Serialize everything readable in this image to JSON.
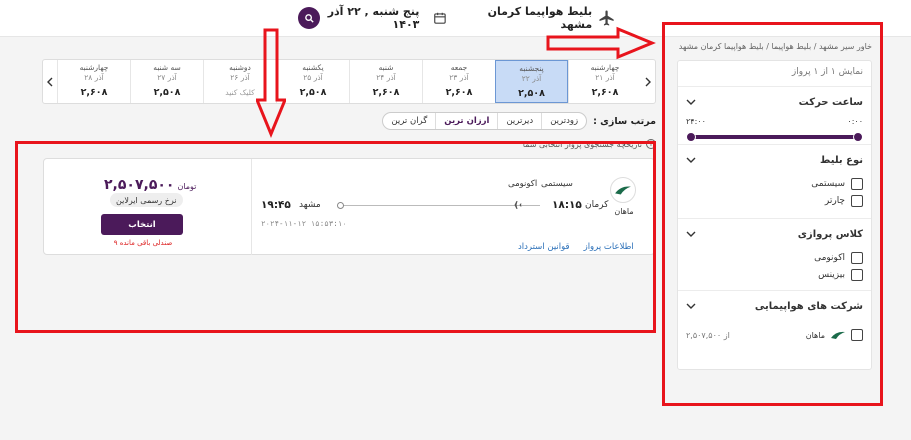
{
  "topbar": {
    "route": "بلیط هواپیما کرمان مشهد",
    "date": "پنج شنبه , ۲۲ آذر ۱۴۰۳"
  },
  "breadcrumb": "خاور سیر مشهد / بلیط هواپیما / بلیط هواپیما کرمان مشهد",
  "sidebar": {
    "results_count": "نمایش ۱ از ۱ پرواز",
    "departure_time": {
      "title": "ساعت حرکت",
      "min": "۰:۰۰",
      "max": "۲۴:۰۰"
    },
    "ticket_type": {
      "title": "نوع بلیط",
      "options": [
        "سیستمی",
        "چارتر"
      ]
    },
    "flight_class": {
      "title": "کلاس پروازی",
      "options": [
        "اکونومی",
        "بیزینس"
      ]
    },
    "airlines": {
      "title": "شرکت های هواپیمایی",
      "name": "ماهان",
      "price": "از ۲,۵۰۷,۵۰۰"
    }
  },
  "date_strip": {
    "days": [
      {
        "name": "چهارشنبه",
        "date": "۲۱ آذر",
        "price": "۲,۶۰۸",
        "state": "normal"
      },
      {
        "name": "پنجشنبه",
        "date": "۲۲ آذر",
        "price": "۲,۵۰۸",
        "state": "active"
      },
      {
        "name": "جمعه",
        "date": "۲۳ آذر",
        "price": "۲,۶۰۸",
        "state": "normal"
      },
      {
        "name": "شنبه",
        "date": "۲۴ آذر",
        "price": "۲,۶۰۸",
        "state": "normal"
      },
      {
        "name": "یکشنبه",
        "date": "۲۵ آذر",
        "price": "۲,۵۰۸",
        "state": "normal"
      },
      {
        "name": "دوشنبه",
        "date": "۲۶ آذر",
        "price": "کلیک کنید",
        "state": "disabled"
      },
      {
        "name": "سه شنبه",
        "date": "۲۷ آذر",
        "price": "۲,۵۰۸",
        "state": "normal"
      },
      {
        "name": "چهارشنبه",
        "date": "۲۸ آذر",
        "price": "۲,۶۰۸",
        "state": "normal"
      }
    ]
  },
  "sort": {
    "label": "مرتب سازی :",
    "options": [
      "زودترین",
      "دیرترین",
      "ارزان ترین",
      "گران ترین"
    ],
    "active_index": 2
  },
  "history_text": "تاریخچه جستجوی پرواز انتخابی شما",
  "flight": {
    "airline": "ماهان",
    "system_tag": "سیستمی",
    "class_tag": "اکونومی",
    "origin": "کرمان",
    "departure_time": "۱۸:۱۵",
    "destination": "مشهد",
    "arrival_time": "۱۹:۴۵",
    "fetched_at": "۲۰۲۴-۱۱-۱۲ ۱۵:۵۳:۱۰",
    "link_info": "اطلاعات پرواز",
    "link_refund": "قوانین استرداد",
    "price": "۲,۵۰۷,۵۰۰",
    "currency": "تومان",
    "fare_type": "نرخ رسمی ایرلاین",
    "select_label": "انتخاب",
    "seats_left": "۹ صندلی باقی مانده"
  },
  "colors": {
    "brand": "#4b1a5a",
    "active_day": "#c8dbf6",
    "annotation": "#e8141c",
    "link": "#2a6fb8"
  }
}
